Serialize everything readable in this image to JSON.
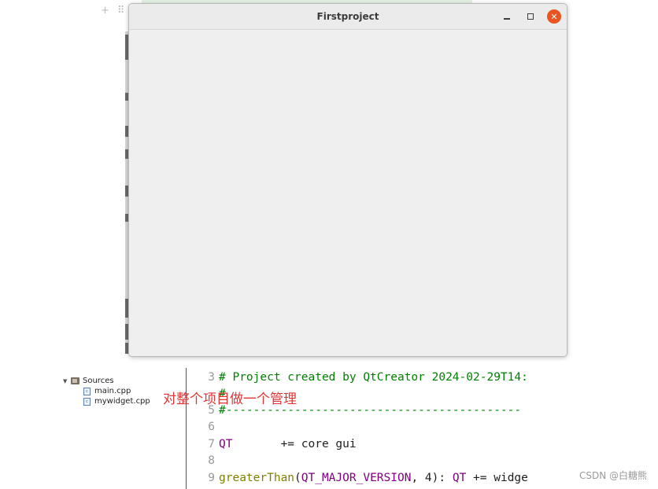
{
  "window": {
    "title": "Firstproject",
    "minimize_label": "–",
    "close_label": "✕"
  },
  "tree": {
    "folder": "Sources",
    "files": [
      "main.cpp",
      "mywidget.cpp"
    ]
  },
  "annotation": "对整个项目做一个管理",
  "editor": {
    "lines": [
      {
        "num": "3",
        "segments": [
          {
            "cls": "comment",
            "text": "# Project created by QtCreator 2024-02-29T14:"
          }
        ]
      },
      {
        "num": "",
        "segments": [
          {
            "cls": "comment",
            "text": "#"
          }
        ]
      },
      {
        "num": "5",
        "segments": [
          {
            "cls": "comment",
            "text": "#-------------------------------------------"
          }
        ]
      },
      {
        "num": "6",
        "segments": []
      },
      {
        "num": "7",
        "segments": [
          {
            "cls": "kw",
            "text": "QT"
          },
          {
            "cls": "plain",
            "text": "       += core gui"
          }
        ]
      },
      {
        "num": "8",
        "segments": []
      },
      {
        "num": "9",
        "segments": [
          {
            "cls": "fn",
            "text": "greaterThan"
          },
          {
            "cls": "plain",
            "text": "("
          },
          {
            "cls": "kw",
            "text": "QT_MAJOR_VERSION"
          },
          {
            "cls": "plain",
            "text": ", 4): "
          },
          {
            "cls": "kw",
            "text": "QT"
          },
          {
            "cls": "plain",
            "text": " += widge"
          }
        ]
      }
    ]
  },
  "watermark": "CSDN @白糖熊",
  "icons": {
    "close": "close-icon",
    "minimize": "minimize-icon",
    "maximize": "maximize-icon",
    "folder": "folder-icon",
    "file": "cpp-file-icon"
  },
  "colors": {
    "close_button": "#e95420",
    "annotation": "#e53333",
    "comment": "#008000",
    "keyword": "#800080",
    "function": "#808000"
  }
}
